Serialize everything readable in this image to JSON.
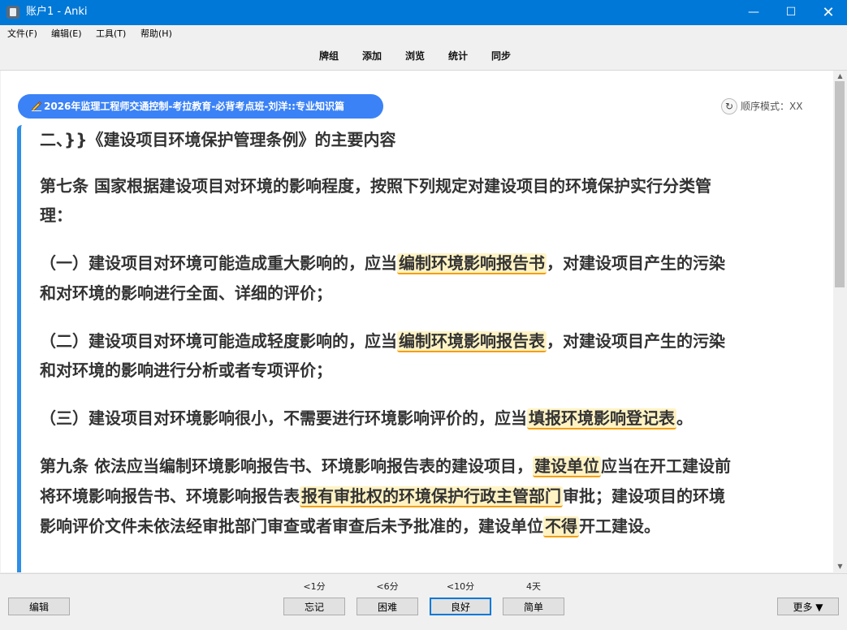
{
  "window": {
    "title": "账户1 - Anki"
  },
  "menu": [
    "文件(F)",
    "编辑(E)",
    "工具(T)",
    "帮助(H)"
  ],
  "toolbar": [
    "牌组",
    "添加",
    "浏览",
    "统计",
    "同步"
  ],
  "deck": {
    "name": "2026年监理工程师交通控制-考拉教育-必背考点班-刘洋::专业知识篇",
    "icon": "pencil-icon"
  },
  "mode": {
    "label": "顺序模式：XX",
    "icon": "refresh-icon"
  },
  "card": {
    "heading": "二、}}《建设项目环境保护管理条例》的主要内容",
    "art7_l1": "第七条 国家根据建设项目对环境的影响程度，按照下列规定对建设项目的环境保护实行分类管",
    "art7_l2": "理：",
    "i1_pre": "（一）建设项目对环境可能造成重大影响的，应当",
    "i1_hl": "编制环境影响报告书",
    "i1_post": "，对建设项目产生的污染",
    "i1_l2": "和对环境的影响进行全面、详细的评价；",
    "i2_pre": "（二）建设项目对环境可能造成轻度影响的，应当",
    "i2_hl": "编制环境影响报告表",
    "i2_post": "，对建设项目产生的污染",
    "i2_l2": "和对环境的影响进行分析或者专项评价；",
    "i3_pre": "（三）建设项目对环境影响很小，不需要进行环境影响评价的，应当",
    "i3_hl": "填报环境影响登记表",
    "i3_post": "。",
    "a9_l1_pre": "第九条 依法应当编制环境影响报告书、环境影响报告表的建设项目，",
    "a9_l1_hl": "建设单位",
    "a9_l1_post": "应当在开工建设前",
    "a9_l2_pre": "将环境影响报告书、环境影响报告表",
    "a9_l2_hl": "报有审批权的环境保护行政主管部门",
    "a9_l2_post": "审批；建设项目的环境",
    "a9_l3_pre": "影响评价文件未依法经审批部门审查或者审查后未予批准的，建设单位",
    "a9_l3_hl": "不得",
    "a9_l3_post": "开工建设。"
  },
  "answers": [
    {
      "due": "<1分",
      "label": "忘记"
    },
    {
      "due": "<6分",
      "label": "困难"
    },
    {
      "due": "<10分",
      "label": "良好"
    },
    {
      "due": "4天",
      "label": "简单"
    }
  ],
  "edit_label": "编辑",
  "more_label": "更多 ▼",
  "colors": {
    "titlebar": "#0078d7",
    "accent": "#3b82f6",
    "highlight_bg": "#fff3c4",
    "highlight_line": "#f59e0b",
    "card_border": "#2f8ee6"
  }
}
